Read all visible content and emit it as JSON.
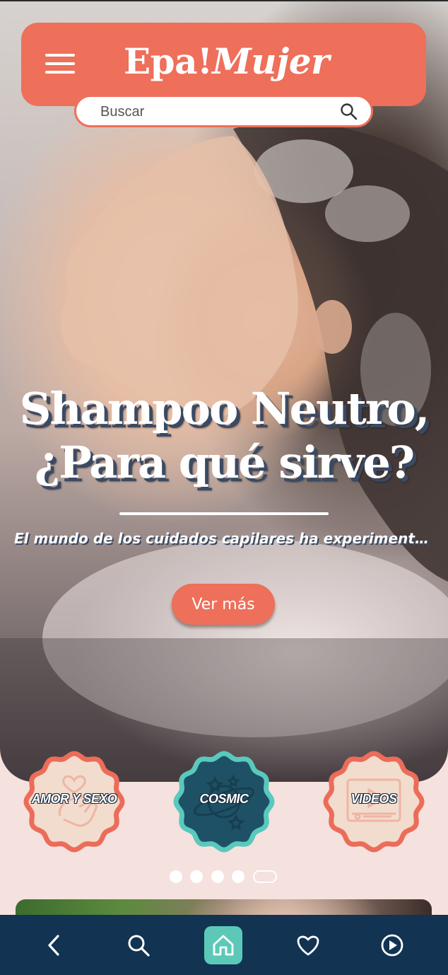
{
  "header": {
    "logo_part1": "Epa!",
    "logo_part2": "Mujer"
  },
  "search": {
    "placeholder": "Buscar"
  },
  "hero": {
    "title_line1": "Shampoo Neutro,",
    "title_line2": "¿Para qué sirve?",
    "excerpt": "El mundo de los cuidados capilares ha experimentad...",
    "cta_label": "Ver más"
  },
  "categories": [
    {
      "label": "AMOR Y SEXO",
      "icon": "heart-hand-icon",
      "fill": "#f2dccd",
      "border": "#ec6c5a"
    },
    {
      "label": "COSMIC",
      "icon": "planet-stars-icon",
      "fill": "#1e5166",
      "border": "#5ac9bd"
    },
    {
      "label": "VIDEOS",
      "icon": "video-player-icon",
      "fill": "#f2dccd",
      "border": "#ec6c5a"
    }
  ],
  "carousel": {
    "total": 5,
    "active_index": 4
  },
  "bottom_nav": {
    "items": [
      "back-icon",
      "search-icon",
      "home-icon",
      "heart-icon",
      "play-icon"
    ],
    "active": "home-icon"
  },
  "colors": {
    "brand": "#ee6f5a",
    "nav_background": "#123352",
    "nav_active": "#5cc9b8",
    "page_background": "#f5e1de"
  }
}
